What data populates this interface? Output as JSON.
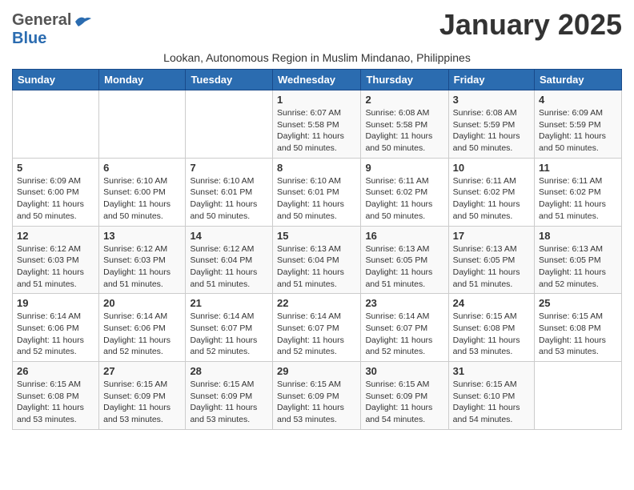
{
  "header": {
    "logo_general": "General",
    "logo_blue": "Blue",
    "month_title": "January 2025",
    "subtitle": "Lookan, Autonomous Region in Muslim Mindanao, Philippines"
  },
  "weekdays": [
    "Sunday",
    "Monday",
    "Tuesday",
    "Wednesday",
    "Thursday",
    "Friday",
    "Saturday"
  ],
  "weeks": [
    [
      {
        "day": "",
        "info": ""
      },
      {
        "day": "",
        "info": ""
      },
      {
        "day": "",
        "info": ""
      },
      {
        "day": "1",
        "info": "Sunrise: 6:07 AM\nSunset: 5:58 PM\nDaylight: 11 hours\nand 50 minutes."
      },
      {
        "day": "2",
        "info": "Sunrise: 6:08 AM\nSunset: 5:58 PM\nDaylight: 11 hours\nand 50 minutes."
      },
      {
        "day": "3",
        "info": "Sunrise: 6:08 AM\nSunset: 5:59 PM\nDaylight: 11 hours\nand 50 minutes."
      },
      {
        "day": "4",
        "info": "Sunrise: 6:09 AM\nSunset: 5:59 PM\nDaylight: 11 hours\nand 50 minutes."
      }
    ],
    [
      {
        "day": "5",
        "info": "Sunrise: 6:09 AM\nSunset: 6:00 PM\nDaylight: 11 hours\nand 50 minutes."
      },
      {
        "day": "6",
        "info": "Sunrise: 6:10 AM\nSunset: 6:00 PM\nDaylight: 11 hours\nand 50 minutes."
      },
      {
        "day": "7",
        "info": "Sunrise: 6:10 AM\nSunset: 6:01 PM\nDaylight: 11 hours\nand 50 minutes."
      },
      {
        "day": "8",
        "info": "Sunrise: 6:10 AM\nSunset: 6:01 PM\nDaylight: 11 hours\nand 50 minutes."
      },
      {
        "day": "9",
        "info": "Sunrise: 6:11 AM\nSunset: 6:02 PM\nDaylight: 11 hours\nand 50 minutes."
      },
      {
        "day": "10",
        "info": "Sunrise: 6:11 AM\nSunset: 6:02 PM\nDaylight: 11 hours\nand 50 minutes."
      },
      {
        "day": "11",
        "info": "Sunrise: 6:11 AM\nSunset: 6:02 PM\nDaylight: 11 hours\nand 51 minutes."
      }
    ],
    [
      {
        "day": "12",
        "info": "Sunrise: 6:12 AM\nSunset: 6:03 PM\nDaylight: 11 hours\nand 51 minutes."
      },
      {
        "day": "13",
        "info": "Sunrise: 6:12 AM\nSunset: 6:03 PM\nDaylight: 11 hours\nand 51 minutes."
      },
      {
        "day": "14",
        "info": "Sunrise: 6:12 AM\nSunset: 6:04 PM\nDaylight: 11 hours\nand 51 minutes."
      },
      {
        "day": "15",
        "info": "Sunrise: 6:13 AM\nSunset: 6:04 PM\nDaylight: 11 hours\nand 51 minutes."
      },
      {
        "day": "16",
        "info": "Sunrise: 6:13 AM\nSunset: 6:05 PM\nDaylight: 11 hours\nand 51 minutes."
      },
      {
        "day": "17",
        "info": "Sunrise: 6:13 AM\nSunset: 6:05 PM\nDaylight: 11 hours\nand 51 minutes."
      },
      {
        "day": "18",
        "info": "Sunrise: 6:13 AM\nSunset: 6:05 PM\nDaylight: 11 hours\nand 52 minutes."
      }
    ],
    [
      {
        "day": "19",
        "info": "Sunrise: 6:14 AM\nSunset: 6:06 PM\nDaylight: 11 hours\nand 52 minutes."
      },
      {
        "day": "20",
        "info": "Sunrise: 6:14 AM\nSunset: 6:06 PM\nDaylight: 11 hours\nand 52 minutes."
      },
      {
        "day": "21",
        "info": "Sunrise: 6:14 AM\nSunset: 6:07 PM\nDaylight: 11 hours\nand 52 minutes."
      },
      {
        "day": "22",
        "info": "Sunrise: 6:14 AM\nSunset: 6:07 PM\nDaylight: 11 hours\nand 52 minutes."
      },
      {
        "day": "23",
        "info": "Sunrise: 6:14 AM\nSunset: 6:07 PM\nDaylight: 11 hours\nand 52 minutes."
      },
      {
        "day": "24",
        "info": "Sunrise: 6:15 AM\nSunset: 6:08 PM\nDaylight: 11 hours\nand 53 minutes."
      },
      {
        "day": "25",
        "info": "Sunrise: 6:15 AM\nSunset: 6:08 PM\nDaylight: 11 hours\nand 53 minutes."
      }
    ],
    [
      {
        "day": "26",
        "info": "Sunrise: 6:15 AM\nSunset: 6:08 PM\nDaylight: 11 hours\nand 53 minutes."
      },
      {
        "day": "27",
        "info": "Sunrise: 6:15 AM\nSunset: 6:09 PM\nDaylight: 11 hours\nand 53 minutes."
      },
      {
        "day": "28",
        "info": "Sunrise: 6:15 AM\nSunset: 6:09 PM\nDaylight: 11 hours\nand 53 minutes."
      },
      {
        "day": "29",
        "info": "Sunrise: 6:15 AM\nSunset: 6:09 PM\nDaylight: 11 hours\nand 53 minutes."
      },
      {
        "day": "30",
        "info": "Sunrise: 6:15 AM\nSunset: 6:09 PM\nDaylight: 11 hours\nand 54 minutes."
      },
      {
        "day": "31",
        "info": "Sunrise: 6:15 AM\nSunset: 6:10 PM\nDaylight: 11 hours\nand 54 minutes."
      },
      {
        "day": "",
        "info": ""
      }
    ]
  ]
}
